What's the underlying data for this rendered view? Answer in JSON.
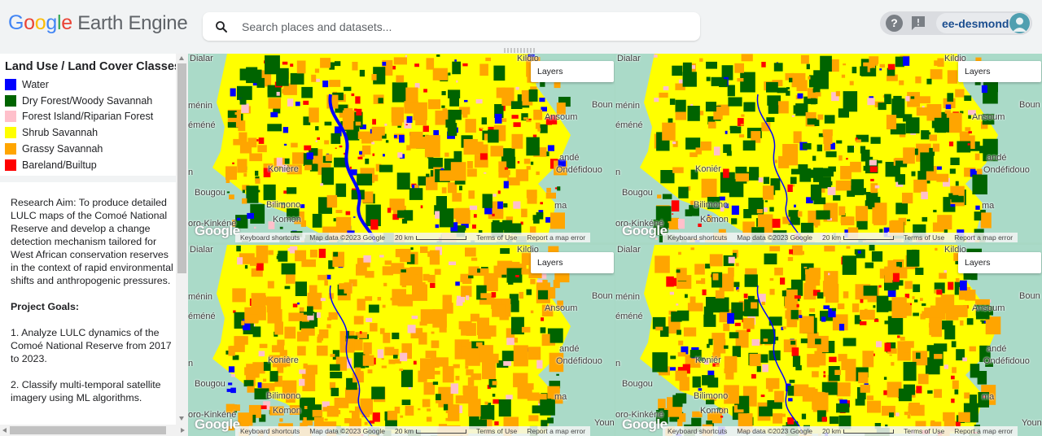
{
  "header": {
    "logo": {
      "g1": "G",
      "g2": "o",
      "g3": "o",
      "g4": "g",
      "g5": "l",
      "g6": "e",
      "rest": " Earth Engine"
    },
    "search_placeholder": "Search places and datasets...",
    "user": "ee-desmond"
  },
  "legend": {
    "title": "Land Use / Land Cover Classes",
    "items": [
      {
        "label": "Water",
        "color": "#0000ff"
      },
      {
        "label": "Dry Forest/Woody Savannah",
        "color": "#006400"
      },
      {
        "label": "Forest Island/Riparian Forest",
        "color": "#ffc0cb"
      },
      {
        "label": "Shrub Savannah",
        "color": "#ffff00"
      },
      {
        "label": "Grassy Savannah",
        "color": "#ffa500"
      },
      {
        "label": "Bareland/Builtup",
        "color": "#ff0000"
      }
    ]
  },
  "description": {
    "research_aim": "Research Aim: To produce detailed LULC maps of the Comoé National Reserve and develop a change detection mechanism tailored for West African conservation reserves in the context of rapid environmental shifts and anthropogenic pressures.",
    "goals_title": "Project Goals:",
    "goal_1": "1. Analyze LULC dynamics of the Comoé National Reserve from 2017 to 2023.",
    "goal_2": "2. Classify multi-temporal satellite imagery using ML algorithms."
  },
  "map": {
    "layers_label": "Layers",
    "watermark": "Google",
    "footer": {
      "shortcuts": "Keyboard shortcuts",
      "map_data": "Map data ©2023 Google",
      "scale": "20 km",
      "terms": "Terms of Use",
      "report": "Report a map error"
    },
    "places": {
      "dialar": "Dialar",
      "kildio": "Kildio",
      "bouna": "Boun",
      "menin": "ménin",
      "emene": "éméné",
      "ansoum": "Ansoum",
      "n_left": "n",
      "koniere": "Konière",
      "konierb": "Koniér",
      "andé": "andé",
      "ondefidouo": "Ondéfidouo",
      "bougou": "Bougou",
      "bilimono": "Bilimono",
      "komon": "Komon",
      "kinkene": "oro-Kinkéné",
      "ma": "ma",
      "youn": "Youn"
    }
  },
  "colors": {
    "water": "#0000ff",
    "dry_forest": "#006400",
    "riparian": "#ffc0cb",
    "shrub": "#ffff00",
    "grassy": "#ffa500",
    "bare": "#ff0000",
    "basemap": "#aadac8"
  }
}
